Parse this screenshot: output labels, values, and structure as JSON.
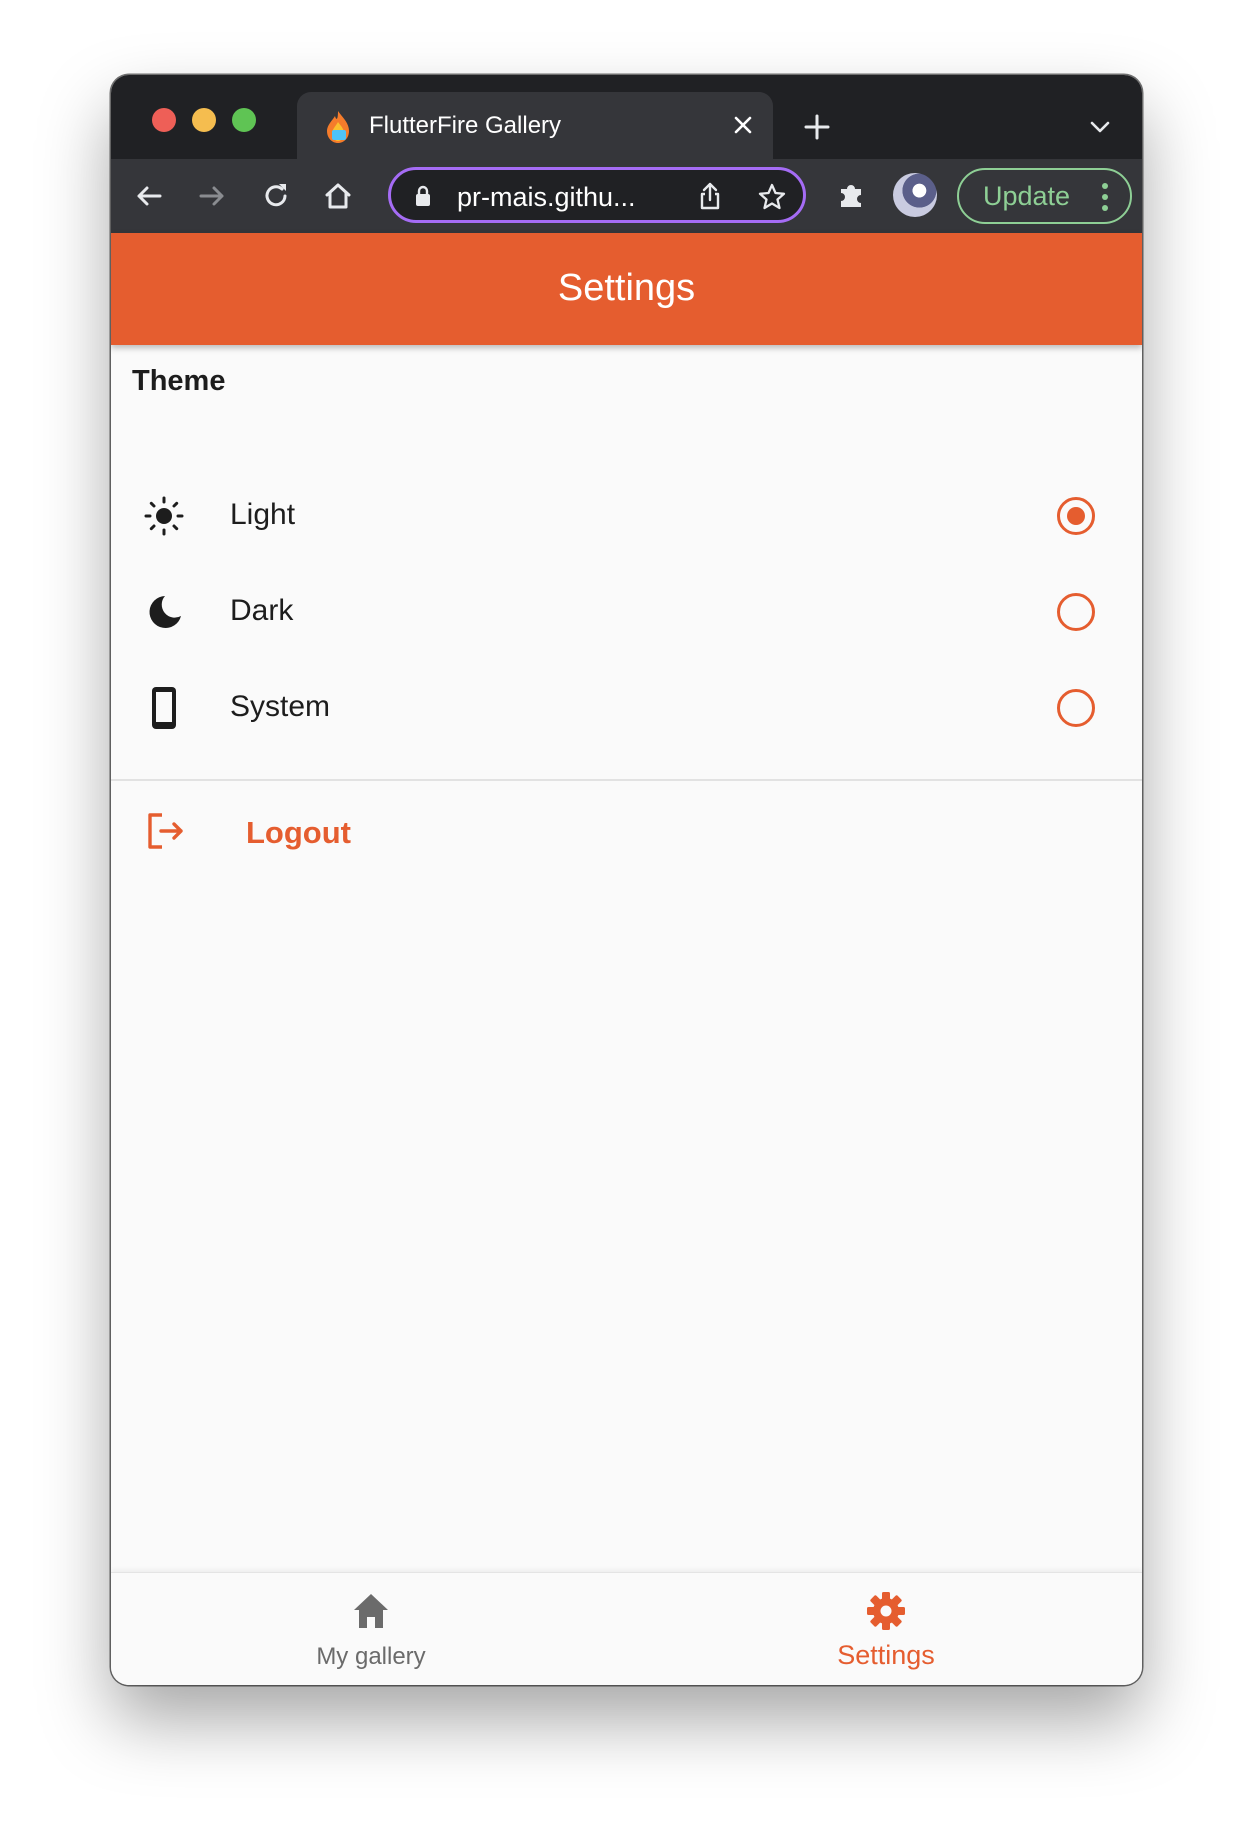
{
  "browser": {
    "tab_title": "FlutterFire Gallery",
    "url": "pr-mais.githu...",
    "update_label": "Update"
  },
  "colors": {
    "accent": "#e55d2f",
    "chrome_dark": "#202124",
    "chrome_toolbar": "#35363a",
    "update_green": "#8ecf95",
    "omnibox_focus": "#a56cf5"
  },
  "appbar": {
    "title": "Settings"
  },
  "theme_section": {
    "title": "Theme",
    "options": [
      {
        "label": "Light",
        "icon": "sun-icon",
        "selected": true
      },
      {
        "label": "Dark",
        "icon": "moon-icon",
        "selected": false
      },
      {
        "label": "System",
        "icon": "phone-icon",
        "selected": false
      }
    ]
  },
  "logout": {
    "label": "Logout",
    "icon": "logout-icon"
  },
  "bottom_nav": {
    "items": [
      {
        "label": "My gallery",
        "icon": "home-icon",
        "active": false
      },
      {
        "label": "Settings",
        "icon": "gear-icon",
        "active": true
      }
    ]
  }
}
